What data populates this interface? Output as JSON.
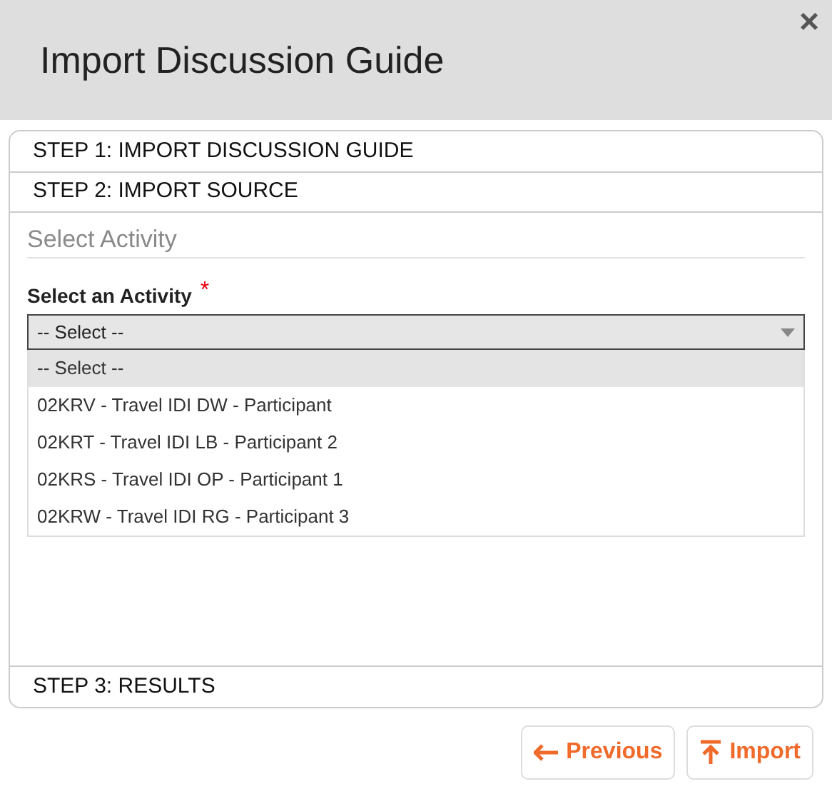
{
  "dialog": {
    "title": "Import Discussion Guide",
    "close": "×"
  },
  "steps": [
    {
      "label": "STEP 1: IMPORT DISCUSSION GUIDE",
      "expanded": false
    },
    {
      "label": "STEP 2: IMPORT SOURCE",
      "expanded": true
    },
    {
      "label": "STEP 3: RESULTS",
      "expanded": false
    }
  ],
  "section": {
    "heading": "Select Activity",
    "field_label": "Select an Activity",
    "required_mark": "*",
    "value": "-- Select --",
    "options": [
      {
        "label": "-- Select --",
        "selected": true
      },
      {
        "label": "02KRV - Travel IDI DW - Participant",
        "selected": false
      },
      {
        "label": "02KRT - Travel IDI LB - Participant 2",
        "selected": false
      },
      {
        "label": "02KRS - Travel IDI OP - Participant 1",
        "selected": false
      },
      {
        "label": "02KRW - Travel IDI RG - Participant 3",
        "selected": false
      }
    ]
  },
  "buttons": [
    {
      "label": "Previous",
      "kind": "back"
    },
    {
      "label": "Import",
      "kind": "import"
    }
  ]
}
